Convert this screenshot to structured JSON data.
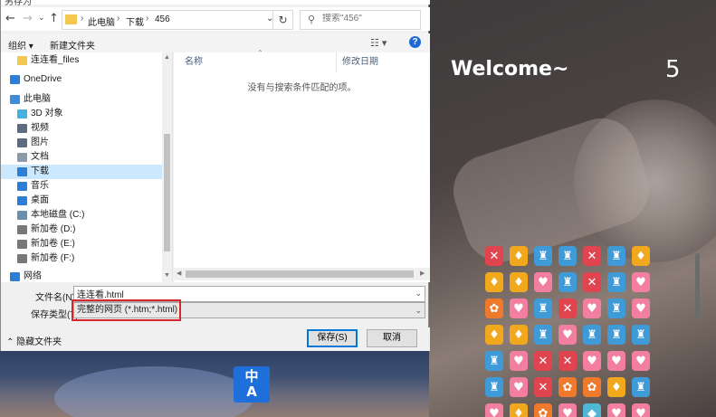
{
  "dialog": {
    "title_fragment": "另存为",
    "address": {
      "crumbs": [
        "此电脑",
        "下载",
        "456"
      ],
      "search_placeholder": "搜索\"456\""
    },
    "toolbar": {
      "organize": "组织 ▾",
      "new_folder": "新建文件夹"
    },
    "nav_items": [
      {
        "label": "连连看_files",
        "icon": "folder-icon",
        "color": "#f4c84e"
      },
      {
        "label": "OneDrive",
        "icon": "cloud-icon",
        "color": "#2b7fd6"
      },
      {
        "label": "此电脑",
        "icon": "computer-icon",
        "color": "#3d8bd9"
      },
      {
        "label": "3D 对象",
        "icon": "cube-icon",
        "color": "#46b1e1"
      },
      {
        "label": "视频",
        "icon": "video-icon",
        "color": "#5a6c7d"
      },
      {
        "label": "图片",
        "icon": "picture-icon",
        "color": "#5a6c7d"
      },
      {
        "label": "文档",
        "icon": "document-icon",
        "color": "#8a9aa9"
      },
      {
        "label": "下载",
        "icon": "download-icon",
        "color": "#2b7fd6",
        "selected": true
      },
      {
        "label": "音乐",
        "icon": "music-icon",
        "color": "#2b7fd6"
      },
      {
        "label": "桌面",
        "icon": "desktop-icon",
        "color": "#2b7fd6"
      },
      {
        "label": "本地磁盘 (C:)",
        "icon": "drive-c-icon",
        "color": "#6a8fb0"
      },
      {
        "label": "新加卷 (D:)",
        "icon": "drive-icon",
        "color": "#777777"
      },
      {
        "label": "新加卷 (E:)",
        "icon": "drive-icon",
        "color": "#777777"
      },
      {
        "label": "新加卷 (F:)",
        "icon": "drive-icon",
        "color": "#777777"
      },
      {
        "label": "网络",
        "icon": "network-icon",
        "color": "#2b7fd6"
      }
    ],
    "columns": {
      "name": "名称",
      "modified": "修改日期"
    },
    "empty_message": "没有与搜索条件匹配的项。",
    "filename_label": "文件名(N):",
    "filename_value": "连连看.html",
    "filetype_label": "保存类型(T):",
    "filetype_value": "完整的网页 (*.htm;*.html)",
    "hide_folders": "隐藏文件夹",
    "save_button": "保存(S)",
    "cancel_button": "取消"
  },
  "page": {
    "welcome": "Welcome~",
    "counter": "5",
    "translate_icon_text": "中A"
  },
  "tiles": [
    [
      "red",
      "yellow",
      "blue",
      "blue",
      "red",
      "blue",
      "yellow"
    ],
    [
      "yellow",
      "yellow",
      "pink",
      "blue",
      "red",
      "blue",
      "pink"
    ],
    [
      "orange",
      "pink",
      "blue",
      "red",
      "pink",
      "blue",
      "pink"
    ],
    [
      "yellow",
      "yellow",
      "blue",
      "pink",
      "blue",
      "blue",
      "blue"
    ],
    [
      "blue",
      "pink",
      "red",
      "red",
      "pink",
      "pink",
      "pink"
    ],
    [
      "blue",
      "pink",
      "red",
      "orange",
      "orange",
      "yellow",
      "blue"
    ],
    [
      "pink",
      "yellow",
      "orange",
      "pink",
      "cyan",
      "pink",
      "pink"
    ]
  ],
  "colors": {
    "accent": "#0078d7",
    "highlight": "#d9262e",
    "selection": "#cce8ff"
  }
}
